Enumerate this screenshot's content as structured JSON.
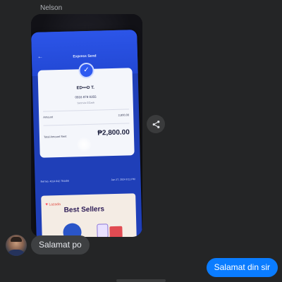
{
  "conversation": {
    "sender_name": "Nelson",
    "messages": [
      {
        "direction": "incoming",
        "text": "Salamat po"
      },
      {
        "direction": "outgoing",
        "text": "Salamat din sir"
      }
    ]
  },
  "photo": {
    "app_title": "Express Send",
    "recipient": "ED•••D T.",
    "recipient_number": "0916 878 8355",
    "sent_via": "Sent via GCash",
    "amount_label": "Amount",
    "amount_value": "2,800.00",
    "total_label": "Total Amount Sent",
    "total_value": "₱2,800.00",
    "ref_label": "Ref No.",
    "ref_value": "4014 842 764456",
    "date": "Jan 27, 2024 8:11 PM",
    "banner_brand": "Lazada",
    "banner_title": "Best Sellers"
  },
  "icons": {
    "share": "share-icon",
    "check": "checkmark-icon"
  },
  "colors": {
    "background": "#242526",
    "incoming_bubble": "#3e4042",
    "outgoing_bubble": "#0a7cff"
  }
}
